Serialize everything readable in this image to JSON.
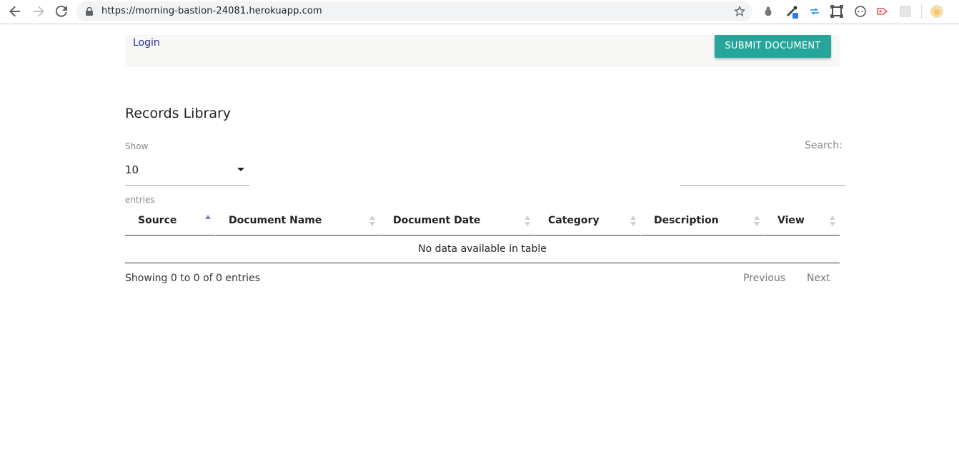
{
  "browser": {
    "url": "https://morning-bastion-24081.herokuapp.com"
  },
  "header": {
    "login_label": "Login",
    "submit_label": "SUBMIT DOCUMENT",
    "accent_color": "#26a69a"
  },
  "main": {
    "title": "Records Library",
    "show_label": "Show",
    "page_length": "10",
    "entries_label": "entries",
    "search_label": "Search:",
    "search_value": ""
  },
  "table": {
    "columns": [
      {
        "label": "Source",
        "sorted": "asc"
      },
      {
        "label": "Document Name",
        "sorted": "none"
      },
      {
        "label": "Document Date",
        "sorted": "none"
      },
      {
        "label": "Category",
        "sorted": "none"
      },
      {
        "label": "Description",
        "sorted": "none"
      },
      {
        "label": "View",
        "sorted": "none"
      }
    ],
    "empty_message": "No data available in table"
  },
  "footer": {
    "info": "Showing 0 to 0 of 0 entries",
    "previous_label": "Previous",
    "next_label": "Next"
  }
}
